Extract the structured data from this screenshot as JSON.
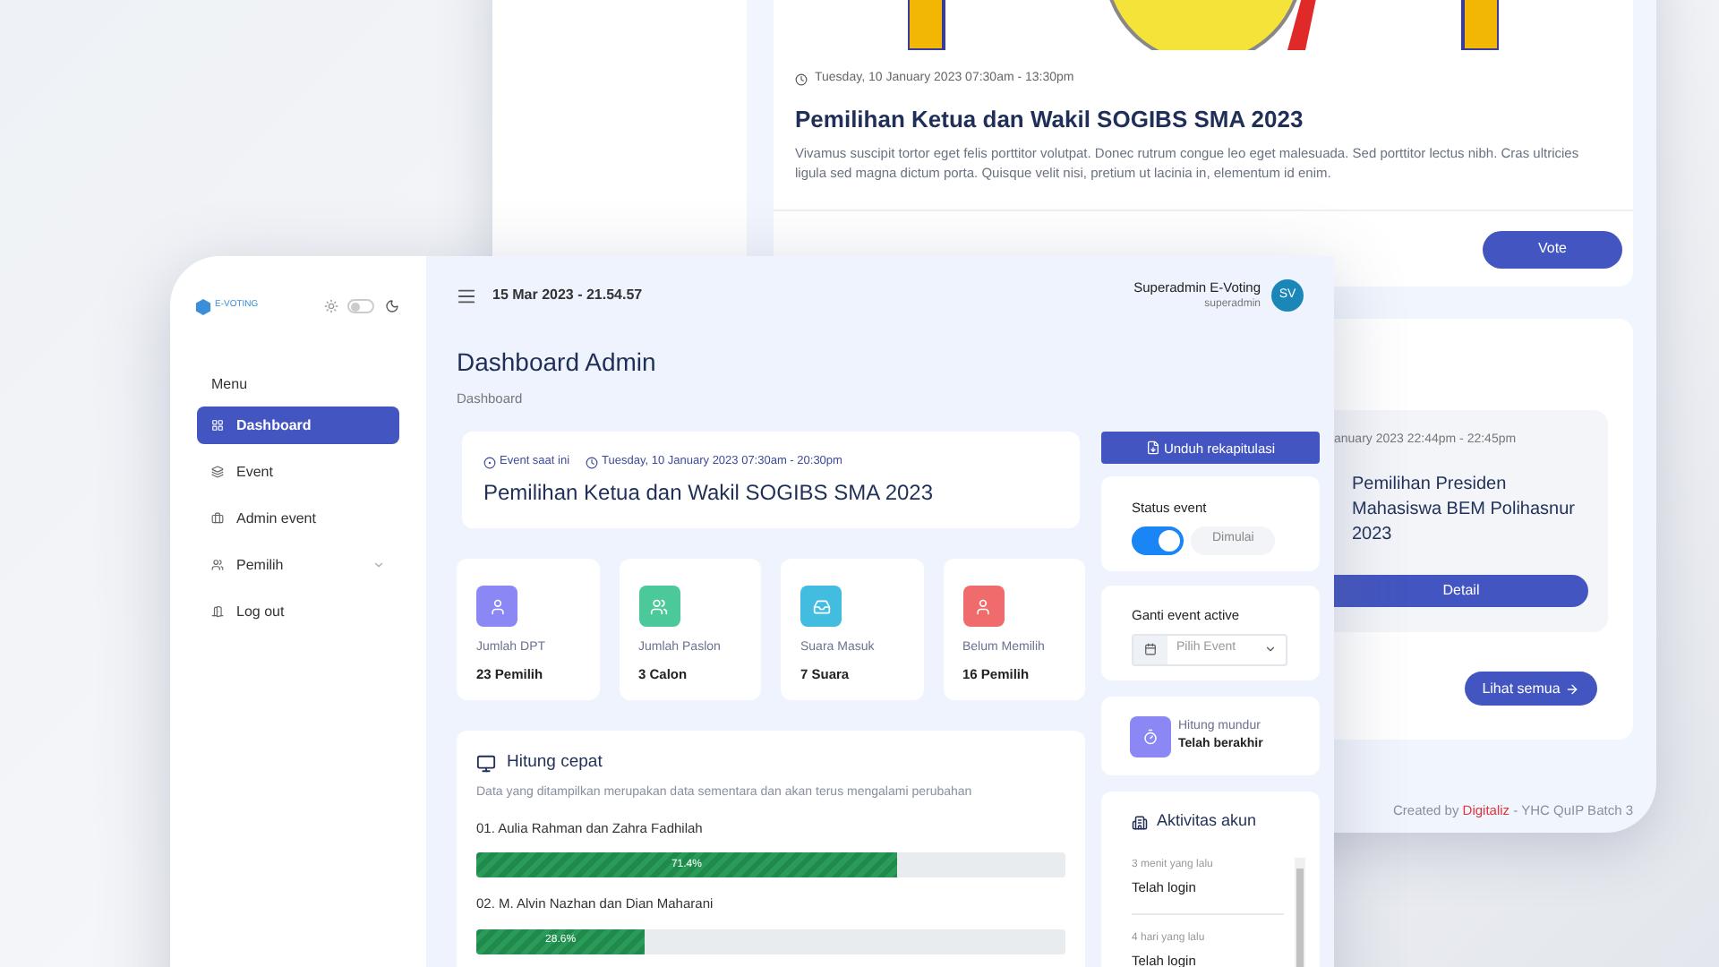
{
  "background_window": {
    "event_card": {
      "date": "Tuesday, 10 January 2023 07:30am - 13:30pm",
      "title": "Pemilihan Ketua dan Wakil SOGIBS SMA 2023",
      "description": "Vivamus suscipit tortor eget felis porttitor volutpat. Donec rutrum congue leo eget malesuada. Sed porttitor lectus nibh. Cras ultricies ligula sed magna dictum porta. Quisque velit nisi, pretium ut lacinia in, elementum id enim.",
      "button": "Vote"
    },
    "upcoming_card": {
      "date": "anuary 2023 22:44pm - 22:45pm",
      "title": "Pemilihan Presiden Mahasiswa BEM Polihasnur 2023",
      "button": "Detail",
      "see_all": "Lihat semua"
    },
    "footer": {
      "prefix": "Created by",
      "brand": "Digitaliz",
      "suffix": "- YHC QuIP Batch 3"
    }
  },
  "sidebar": {
    "logo": "E-VOTING",
    "dark_mode": false,
    "section": "Menu",
    "items": [
      {
        "kind": "grid",
        "label": "Dashboard",
        "selected": true,
        "expandable": false
      },
      {
        "kind": "layers",
        "label": "Event",
        "selected": false,
        "expandable": false
      },
      {
        "kind": "briefcase",
        "label": "Admin event",
        "selected": false,
        "expandable": false
      },
      {
        "kind": "users",
        "label": "Pemilih",
        "selected": false,
        "expandable": true
      },
      {
        "kind": "logout",
        "label": "Log out",
        "selected": false,
        "expandable": false
      }
    ]
  },
  "header": {
    "datetime": "15 Mar 2023 - 21.54.57",
    "user_name": "Superadmin E-Voting",
    "user_role": "superadmin",
    "avatar": "SV"
  },
  "page": {
    "title": "Dashboard Admin",
    "breadcrumb": "Dashboard"
  },
  "current_event": {
    "tag": "Event saat ini",
    "date": "Tuesday, 10 January 2023 07:30am - 20:30pm",
    "title": "Pemilihan Ketua dan Wakil SOGIBS SMA 2023"
  },
  "stats": [
    {
      "kind": "user",
      "label": "Jumlah DPT",
      "value": "23 Pemilih",
      "color": "#8b87f5"
    },
    {
      "kind": "users",
      "label": "Jumlah Paslon",
      "value": "3 Calon",
      "color": "#4cc99a"
    },
    {
      "kind": "inbox",
      "label": "Suara Masuk",
      "value": "7 Suara",
      "color": "#42bde0"
    },
    {
      "kind": "user",
      "label": "Belum Memilih",
      "value": "16 Pemilih",
      "color": "#f06b6b"
    }
  ],
  "quick_count": {
    "title": "Hitung cepat",
    "note": "Data yang ditampilkan merupakan data sementara dan akan terus mengalami perubahan",
    "candidates": [
      {
        "name": "01. Aulia Rahman dan Zahra Fadhilah",
        "level": 0.714,
        "reading": "71.4%"
      },
      {
        "name": "02. M. Alvin Nazhan dan Dian Maharani",
        "level": 0.286,
        "reading": "28.6%"
      }
    ]
  },
  "download_button": "Unduh rekapitulasi",
  "status_event": {
    "label": "Status event",
    "on": true,
    "state": "Dimulai"
  },
  "change_event": {
    "label": "Ganti event active",
    "placeholder": "Pilih Event"
  },
  "countdown": {
    "label": "Hitung mundur",
    "value": "Telah berakhir"
  },
  "activity": {
    "title": "Aktivitas akun",
    "items": [
      {
        "time": "3 menit yang lalu",
        "action": "Telah login"
      },
      {
        "time": "4 hari yang lalu",
        "action": "Telah login"
      }
    ]
  }
}
